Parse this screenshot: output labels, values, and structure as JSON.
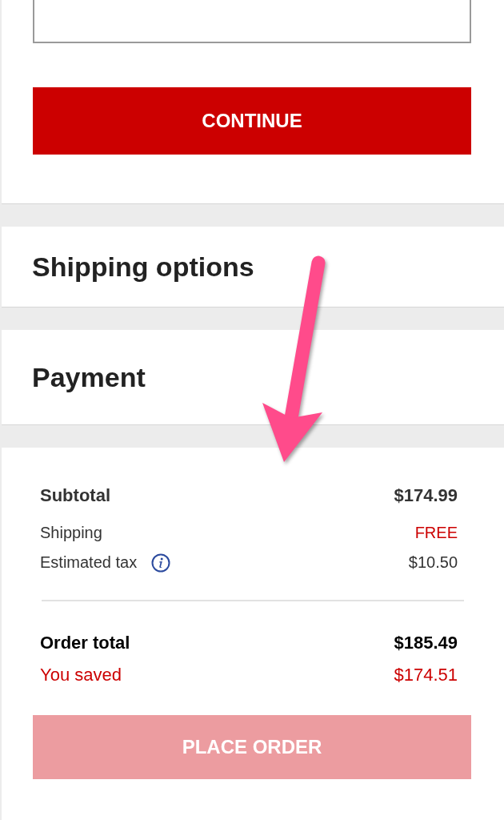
{
  "address_form": {
    "continue_button": {
      "label": "CONTINUE",
      "disabled": false
    }
  },
  "sections": [
    {
      "title": "Shipping options"
    },
    {
      "title": "Payment"
    }
  ],
  "summary": {
    "lines": [
      {
        "kind": "subtotal",
        "label": "Subtotal",
        "value": "$174.99",
        "highlight": false,
        "info": false
      },
      {
        "kind": "detail",
        "label": "Shipping",
        "value": "FREE",
        "highlight": true,
        "info": false
      },
      {
        "kind": "detail",
        "label": "Estimated tax",
        "value": "$10.50",
        "highlight": false,
        "info": true
      }
    ],
    "totals": [
      {
        "kind": "total",
        "label": "Order total",
        "value": "$185.49",
        "highlight": false
      },
      {
        "kind": "savings",
        "label": "You saved",
        "value": "$174.51",
        "highlight": true
      }
    ],
    "place_order_button": {
      "label": "PLACE ORDER",
      "disabled": true
    }
  }
}
